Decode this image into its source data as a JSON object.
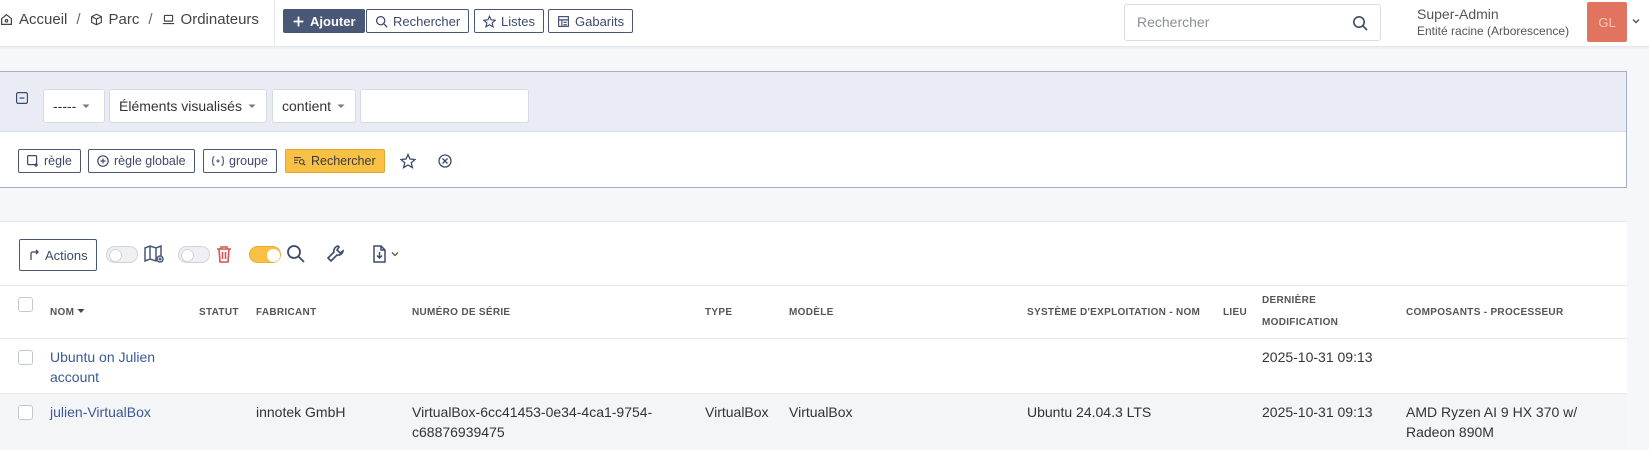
{
  "breadcrumb": {
    "home": "Accueil",
    "parc": "Parc",
    "current": "Ordinateurs",
    "separator": "/"
  },
  "toolbar": {
    "add": "Ajouter",
    "search": "Rechercher",
    "lists": "Listes",
    "templates": "Gabarits"
  },
  "global_search": {
    "placeholder": "Rechercher"
  },
  "user": {
    "name": "Super-Admin",
    "entity": "Entité racine (Arborescence)",
    "initials": "GL"
  },
  "criteria": {
    "field_operator": "-----",
    "field": "Éléments visualisés",
    "condition": "contient",
    "value": "",
    "buttons": {
      "rule": "règle",
      "global_rule": "règle globale",
      "group": "groupe",
      "search": "Rechercher"
    }
  },
  "results": {
    "actions_label": "Actions",
    "columns": [
      "NOM",
      "STATUT",
      "FABRICANT",
      "NUMÉRO DE SÉRIE",
      "TYPE",
      "MODÈLE",
      "SYSTÈME D'EXPLOITATION - NOM",
      "LIEU",
      "DERNIÈRE",
      "MODIFICATION",
      "COMPOSANTS - PROCESSEUR"
    ],
    "rows": [
      {
        "name_l1": "Ubuntu on Julien",
        "name_l2": "account",
        "status": "",
        "manufacturer": "",
        "serial_l1": "",
        "serial_l2": "",
        "type": "",
        "model": "",
        "os": "",
        "location": "",
        "modified": "2025-10-31 09:13",
        "cpu_l1": "",
        "cpu_l2": ""
      },
      {
        "name_l1": "julien-VirtualBox",
        "name_l2": "",
        "status": "",
        "manufacturer": "innotek GmbH",
        "serial_l1": "VirtualBox-6cc41453-0e34-4ca1-9754-",
        "serial_l2": "c68876939475",
        "type": "VirtualBox",
        "model": "VirtualBox",
        "os": "Ubuntu 24.04.3 LTS",
        "location": "",
        "modified": "2025-10-31 09:13",
        "cpu_l1": "AMD Ryzen AI 9 HX 370 w/",
        "cpu_l2": "Radeon 890M"
      }
    ]
  },
  "colors": {
    "primary": "#4a5878",
    "warning": "#f8c146",
    "avatar": "#e0745f",
    "link": "#3b5998",
    "danger": "#d9534f"
  }
}
